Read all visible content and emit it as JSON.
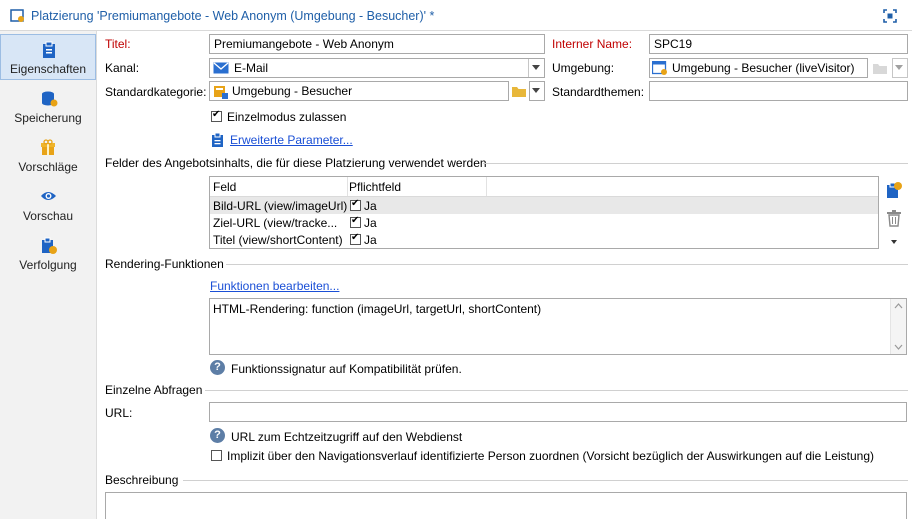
{
  "window": {
    "title": "Platzierung 'Premiumangebote - Web Anonym (Umgebung - Besucher)' *"
  },
  "sidebar": {
    "items": [
      {
        "label": "Eigenschaften",
        "icon": "clipboard-icon"
      },
      {
        "label": "Speicherung",
        "icon": "database-icon"
      },
      {
        "label": "Vorschläge",
        "icon": "gift-icon"
      },
      {
        "label": "Vorschau",
        "icon": "eye-icon"
      },
      {
        "label": "Verfolgung",
        "icon": "tracking-icon"
      }
    ]
  },
  "form": {
    "titel_label": "Titel:",
    "titel_value": "Premiumangebote - Web Anonym",
    "interner_name_label": "Interner Name:",
    "interner_name_value": "SPC19",
    "kanal_label": "Kanal:",
    "kanal_value": "E-Mail",
    "umgebung_label": "Umgebung:",
    "umgebung_value": "Umgebung - Besucher (liveVisitor)",
    "standardkategorie_label": "Standardkategorie:",
    "standardkategorie_value": "Umgebung - Besucher",
    "standardthemen_label": "Standardthemen:",
    "standardthemen_value": "",
    "einzelmodus_label": "Einzelmodus zulassen",
    "einzelmodus_checked": true,
    "erweiterte_link": "Erweiterte Parameter..."
  },
  "felder": {
    "section_title": "Felder des Angebotsinhalts, die für diese Platzierung verwendet werden",
    "columns": [
      "Feld",
      "Pflichtfeld"
    ],
    "rows": [
      {
        "feld": "Bild-URL (view/imageUrl)",
        "pflicht": "Ja"
      },
      {
        "feld": "Ziel-URL (view/tracke...",
        "pflicht": "Ja"
      },
      {
        "feld": "Titel (view/shortContent)",
        "pflicht": "Ja"
      }
    ]
  },
  "rendering": {
    "section_title": "Rendering-Funktionen",
    "edit_link": "Funktionen bearbeiten...",
    "text": "HTML-Rendering: function (imageUrl, targetUrl, shortContent)",
    "help_text": "Funktionssignatur auf Kompatibilität prüfen."
  },
  "abfragen": {
    "section_title": "Einzelne Abfragen",
    "url_label": "URL:",
    "url_value": "",
    "help_text": "URL zum Echtzeitzugriff auf den Webdienst",
    "checkbox_label": "Implizit über den Navigationsverlauf identifizierte Person zuordnen (Vorsicht bezüglich der Auswirkungen auf die Leistung)",
    "checkbox_checked": false
  },
  "beschreibung": {
    "section_title": "Beschreibung"
  },
  "colors": {
    "title_blue": "#1f5fa8",
    "required_red": "#c00000",
    "link_blue": "#1a4fd6",
    "active_tab": "#d8e6f6"
  }
}
